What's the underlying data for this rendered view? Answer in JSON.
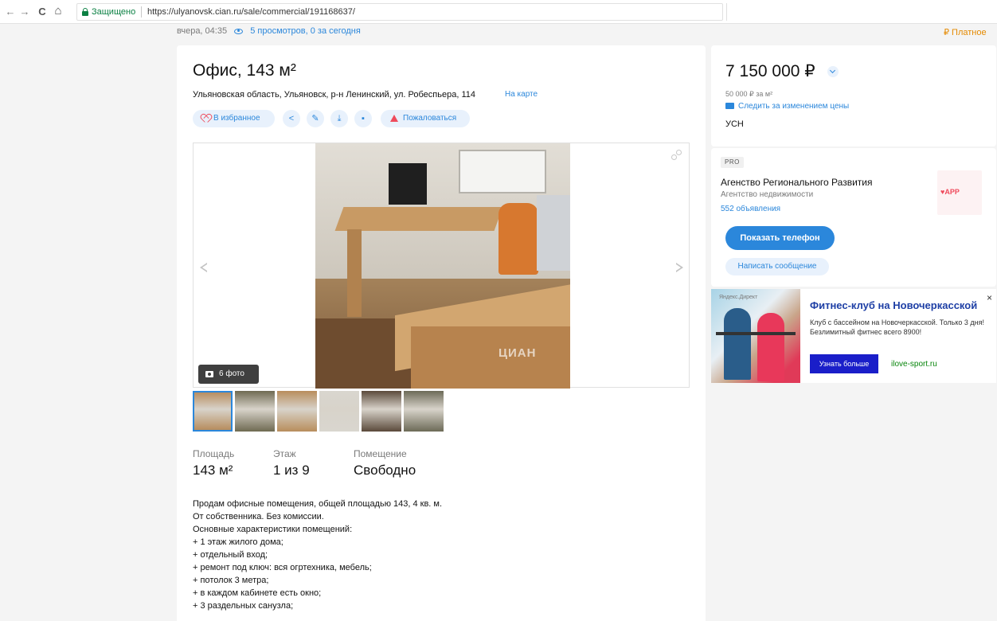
{
  "browser": {
    "back": "←",
    "forward": "→",
    "reload": "C",
    "home": "⌂",
    "secure_label": "Защищено",
    "url": "https://ulyanovsk.cian.ru/sale/commercial/191168637/"
  },
  "meta": {
    "date": "вчера, 04:35",
    "views": "5 просмотров, 0 за сегодня",
    "paid_label": "₽ Платное"
  },
  "listing": {
    "title": "Офис, 143 м²",
    "address": "Ульяновская область, Ульяновск, р-н Ленинский, ул. Робеспьера, 114",
    "map_link": "На карте",
    "actions": {
      "favorite": "В избранное",
      "share_icon": "<",
      "edit_icon": "✎",
      "download_icon": "⤓",
      "print_icon": "▪",
      "complain": "Пожаловаться"
    },
    "gallery": {
      "watermark": "ЦИАН",
      "photo_count": "6 фото",
      "thumbs": [
        {
          "color": "#b48756"
        },
        {
          "color": "#6f6a52"
        },
        {
          "color": "#b88d5c"
        },
        {
          "color": "#d9d6cf"
        },
        {
          "color": "#5b4a3b"
        },
        {
          "color": "#6c6a57"
        }
      ]
    },
    "params": [
      {
        "label": "Площадь",
        "value": "143 м²"
      },
      {
        "label": "Этаж",
        "value": "1 из 9"
      },
      {
        "label": "Помещение",
        "value": "Свободно"
      }
    ],
    "description": [
      "Продам офисные помещения, общей площадью 143, 4 кв. м.",
      "От собственника. Без комиссии.",
      "Основные характеристики помещений:",
      "+ 1 этаж жилого дома;",
      "+ отдельный вход;",
      "+ ремонт под ключ: вся огртехника, мебель;",
      "+ потолок 3 метра;",
      "+ в каждом кабинете есть окно;",
      "+ 3 раздельных санузла;"
    ]
  },
  "price_card": {
    "price": "7 150 000 ₽",
    "price_per_m2": "50 000 ₽ за м²",
    "watch_price": "Следить за изменением цены",
    "tax": "УСН"
  },
  "agent_card": {
    "badge": "PRO",
    "name": "Агенство Регионального Развития",
    "type": "Агентство недвижимости",
    "listings": "552 объявления",
    "logo_text": "♥APP",
    "show_phone": "Показать телефон",
    "write_message": "Написать сообщение"
  },
  "ad": {
    "label": "Яндекс.Директ",
    "close": "×",
    "title": "Фитнес-клуб на Новочеркасской",
    "text": "Клуб с бассейном на Новочеркасской. Только 3 дня! Безлимитный фитнес всего 8900!",
    "button": "Узнать больше",
    "domain": "ilove-sport.ru"
  },
  "colors": {
    "accent": "#2b87db",
    "accent_light": "#e8f1fc",
    "danger": "#ef4b5c",
    "paid": "#e58a00",
    "secure": "#0b8043",
    "ad_title": "#1e3fa5",
    "ad_button": "#1a1ec9",
    "ad_domain": "#07850b"
  },
  "icons": [
    "back-arrow-icon",
    "forward-arrow-icon",
    "reload-icon",
    "home-icon",
    "lock-icon",
    "eye-icon",
    "heart-icon",
    "share-icon",
    "edit-icon",
    "download-icon",
    "print-icon",
    "warning-icon",
    "expand-icon",
    "camera-icon",
    "chevron-left-icon",
    "chevron-right-icon",
    "mail-icon",
    "close-icon"
  ]
}
